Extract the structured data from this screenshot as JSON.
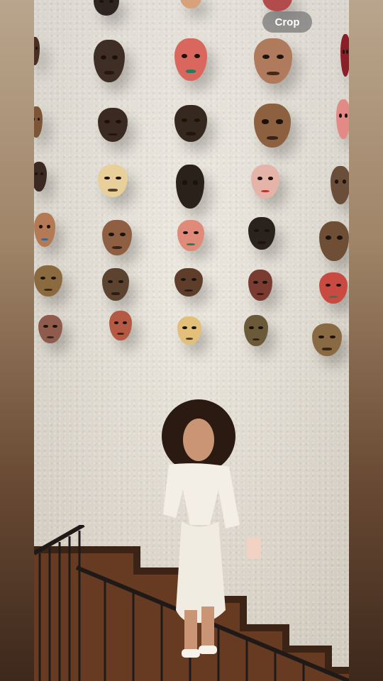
{
  "toolbar": {
    "crop_label": "Crop"
  },
  "colors": {
    "wall": "#ebe6dc",
    "crop_button_bg": "#7d7d7d",
    "railing": "#1f1a17",
    "stairs": "#3a2416"
  },
  "photo": {
    "subject": "woman-in-white-outfit",
    "icons": [
      "mask-wall-decor",
      "stair-railing"
    ]
  }
}
